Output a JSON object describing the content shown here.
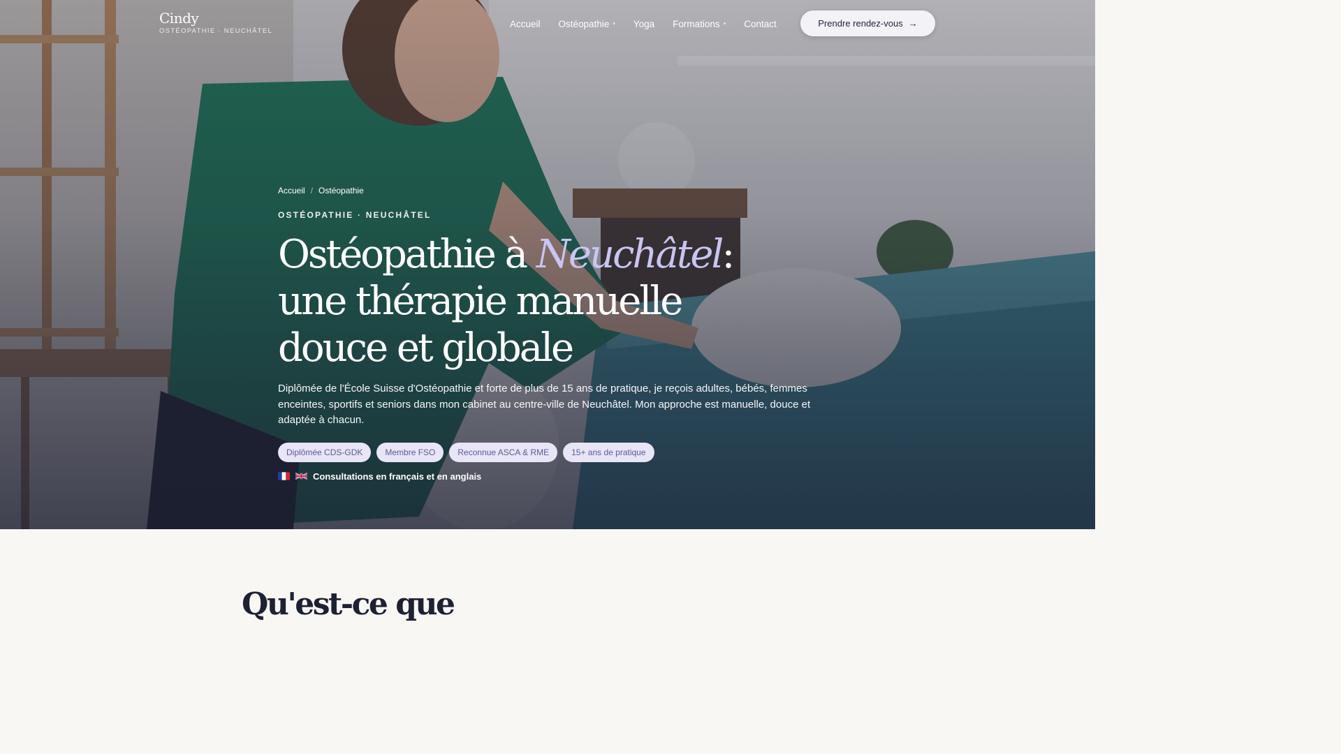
{
  "header": {
    "brand_name": "Cindy",
    "brand_sub": "OSTÉOPATHIE · NEUCHÂTEL",
    "nav": [
      {
        "label": "Accueil",
        "has_dropdown": false
      },
      {
        "label": "Ostéopathie",
        "has_dropdown": true
      },
      {
        "label": "Yoga",
        "has_dropdown": false
      },
      {
        "label": "Formations",
        "has_dropdown": true
      },
      {
        "label": "Contact",
        "has_dropdown": false
      }
    ],
    "cta_label": "Prendre rendez-vous",
    "cta_arrow": "→"
  },
  "hero": {
    "breadcrumb": [
      "Accueil",
      "Ostéopathie"
    ],
    "breadcrumb_sep": "/",
    "eyebrow": "OSTÉOPATHIE · NEUCHÂTEL",
    "title_before": "Ostéopathie à ",
    "title_accent": "Neuchâtel",
    "title_after": ": une thérapie manuelle douce et globale",
    "description": "Diplômée de l'École Suisse d'Ostéopathie et forte de plus de 15 ans de pratique, je reçois adultes, bébés, femmes enceintes, sportifs et seniors dans mon cabinet au centre-ville de Neuchâtel. Mon approche est manuelle, douce et adaptée à chacun.",
    "badges": [
      "Diplômée CDS-GDK",
      "Membre FSO",
      "Reconnue ASCA & RME",
      "15+ ans de pratique"
    ],
    "languages_text": "Consultations en français et en anglais"
  },
  "intro": {
    "title": "Qu'est-ce que"
  },
  "colors": {
    "accent_text": "#c9c5f2",
    "badge_bg": "#e7e5f6",
    "badge_text": "#5f5a99",
    "page_bg": "#f8f7f4",
    "heading_dark": "#1e2034"
  }
}
